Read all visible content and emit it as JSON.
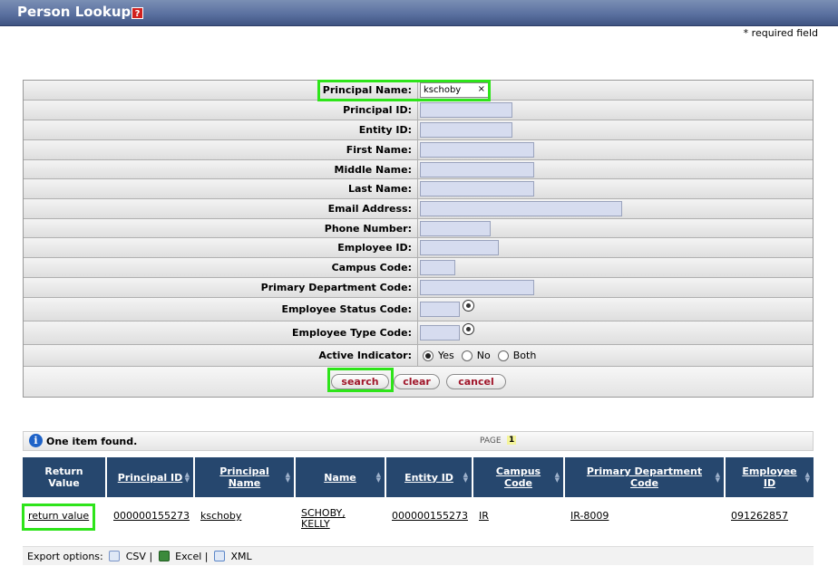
{
  "header": {
    "title": "Person Lookup",
    "help_icon": "help-icon"
  },
  "required_note": "* required field",
  "form": {
    "fields": [
      {
        "label": "Principal Name:",
        "value": "kschoby"
      },
      {
        "label": "Principal ID:",
        "value": ""
      },
      {
        "label": "Entity ID:",
        "value": ""
      },
      {
        "label": "First Name:",
        "value": ""
      },
      {
        "label": "Middle Name:",
        "value": ""
      },
      {
        "label": "Last Name:",
        "value": ""
      },
      {
        "label": "Email Address:",
        "value": ""
      },
      {
        "label": "Phone Number:",
        "value": ""
      },
      {
        "label": "Employee ID:",
        "value": ""
      },
      {
        "label": "Campus Code:",
        "value": ""
      },
      {
        "label": "Primary Department Code:",
        "value": ""
      },
      {
        "label": "Employee Status Code:",
        "value": ""
      },
      {
        "label": "Employee Type Code:",
        "value": ""
      },
      {
        "label": "Active Indicator:"
      }
    ],
    "clear_glyph": "×",
    "active_options": [
      "Yes",
      "No",
      "Both"
    ],
    "active_selected": "Yes",
    "buttons": {
      "search": "search",
      "clear": "clear",
      "cancel": "cancel"
    }
  },
  "results": {
    "message": "One item found.",
    "page_label": "PAGE",
    "page_number": "1",
    "columns": [
      "Return Value",
      "Principal ID",
      "Principal Name",
      "Name",
      "Entity ID",
      "Campus Code",
      "Primary Department Code",
      "Employee ID"
    ],
    "row": {
      "return_value": "return value",
      "principal_id": "000000155273",
      "principal_name": "kschoby",
      "name": "SCHOBY, KELLY",
      "entity_id": "000000155273",
      "campus_code": "IR",
      "primary_department_code": "IR-8009",
      "employee_id": "091262857"
    }
  },
  "export": {
    "label": "Export options:",
    "csv": "CSV",
    "excel": "Excel",
    "xml": "XML",
    "sep": "|"
  },
  "colors": {
    "header_bg": "#26476e",
    "input_bg": "#d6dcef",
    "highlight": "#2ee41a",
    "button_text": "#a0162a"
  }
}
